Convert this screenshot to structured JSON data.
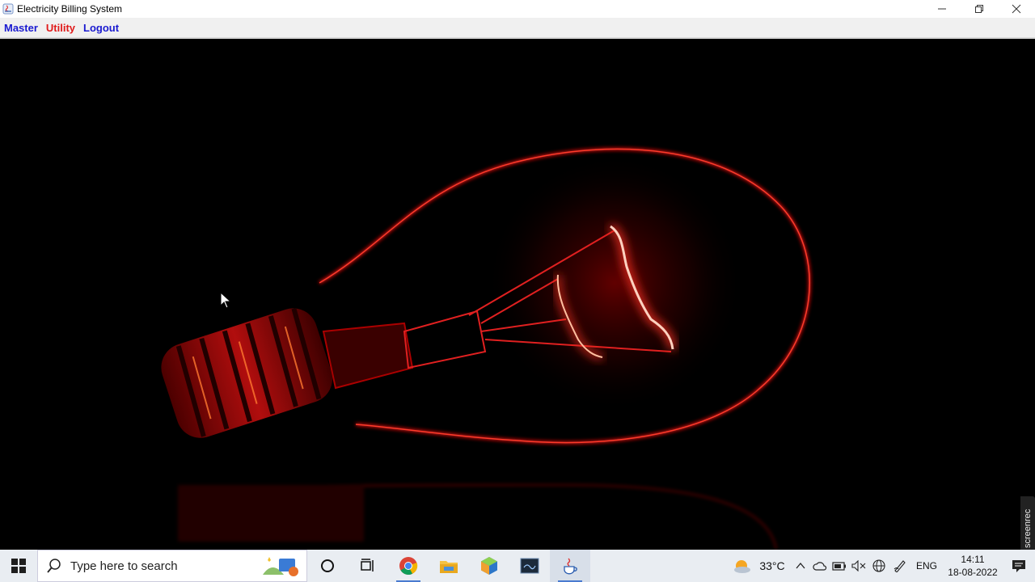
{
  "window": {
    "title": "Electricity Billing System"
  },
  "menu": [
    {
      "label": "Master",
      "color": "#1a1ad0"
    },
    {
      "label": "Utility",
      "color": "#e01b1b"
    },
    {
      "label": "Logout",
      "color": "#1a1ad0"
    }
  ],
  "background_image": {
    "icon": "light-bulb-image"
  },
  "taskbar": {
    "search_placeholder": "Type here to search",
    "weather": "33°C",
    "language": "ENG",
    "time": "14:11",
    "date": "18-08-2022"
  },
  "watermark": "screenrec"
}
